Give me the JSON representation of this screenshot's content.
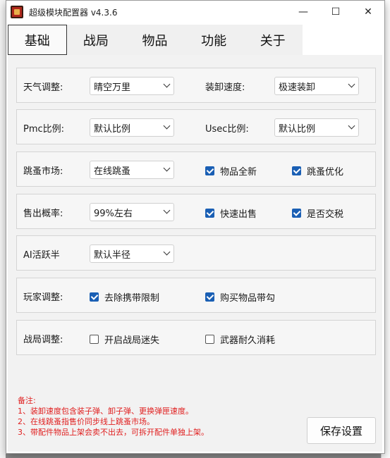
{
  "window": {
    "title": "超级模块配置器 v4.3.6",
    "controls": {
      "minimize": "—",
      "maximize": "☐",
      "close": "✕"
    }
  },
  "tabs": [
    {
      "label": "基础",
      "active": true
    },
    {
      "label": "战局",
      "active": false
    },
    {
      "label": "物品",
      "active": false
    },
    {
      "label": "功能",
      "active": false
    },
    {
      "label": "关于",
      "active": false
    }
  ],
  "rows": {
    "weather": {
      "label": "天气调整:",
      "value": "晴空万里"
    },
    "reload": {
      "label": "装卸速度:",
      "value": "极速装卸"
    },
    "pmc": {
      "label": "Pmc比例:",
      "value": "默认比例"
    },
    "usec": {
      "label": "Usec比例:",
      "value": "默认比例"
    },
    "flea": {
      "label": "跳蚤市场:",
      "value": "在线跳蚤",
      "chk1": "物品全新",
      "chk2": "跳蚤优化"
    },
    "sell": {
      "label": "售出概率:",
      "value": "99%左右",
      "chk1": "快速出售",
      "chk2": "是否交税"
    },
    "ai": {
      "label": "AI活跃半",
      "value": "默认半径"
    },
    "player": {
      "label": "玩家调整:",
      "chk1": "去除携带限制",
      "chk2": "购买物品带勾"
    },
    "raid": {
      "label": "战局调整:",
      "chk1": "开启战局迷失",
      "chk2": "武器耐久消耗"
    }
  },
  "checks": {
    "flea_new": true,
    "flea_opt": true,
    "fast_sell": true,
    "tax": true,
    "no_limit": true,
    "found_in_raid": true,
    "lost": false,
    "durability": false
  },
  "notes": {
    "title": "备注:",
    "line1": "1、装卸速度包含装子弹、卸子弹、更换弹匣速度。",
    "line2": "2、在线跳蚤指售价同步线上跳蚤市场。",
    "line3": "3、带配件物品上架会卖不出去，可拆开配件单独上架。"
  },
  "save_label": "保存设置",
  "colors": {
    "accent": "#1a5fb4",
    "note_red": "#e02020"
  }
}
